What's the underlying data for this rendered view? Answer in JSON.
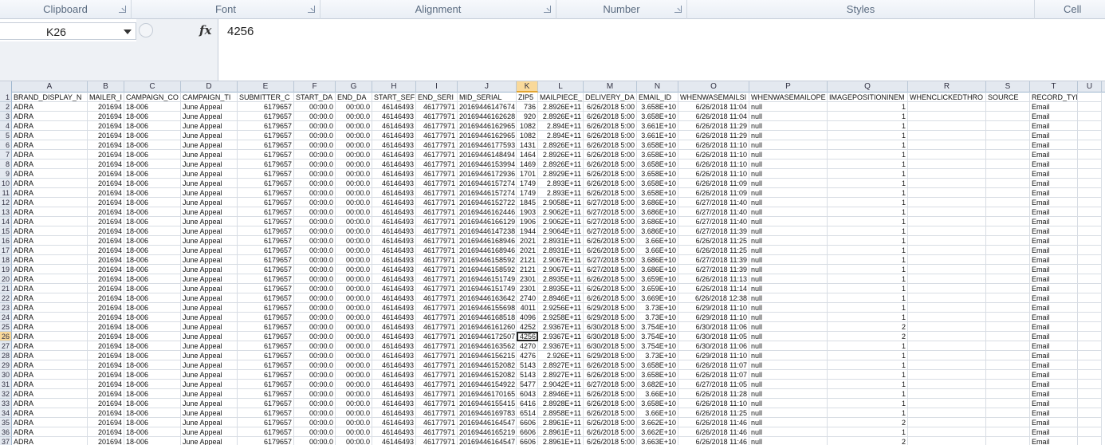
{
  "ribbon": {
    "groups": [
      "Clipboard",
      "Font",
      "Alignment",
      "Number",
      "Styles",
      "Cell"
    ]
  },
  "formula_bar": {
    "name_box": "K26",
    "fx_label": "fx",
    "value": "4256"
  },
  "sheet": {
    "column_letters": [
      "A",
      "B",
      "C",
      "D",
      "E",
      "F",
      "G",
      "H",
      "I",
      "J",
      "K",
      "L",
      "M",
      "N",
      "O",
      "P",
      "Q",
      "R",
      "S",
      "T",
      "U"
    ],
    "selected_column": "K",
    "selected_row": 26,
    "headers": [
      "BRAND_DISPLAY_N",
      "MAILER_I",
      "CAMPAIGN_CO",
      "CAMPAIGN_TI",
      "SUBMITTER_C",
      "START_DA",
      "END_DA",
      "START_SEF",
      "END_SERI",
      "MID_SERIAL",
      "ZIP5",
      "MAILPIECE_",
      "DELIVERY_DA",
      "EMAIL_ID",
      "WHENWASEMAILSI",
      "WHENWASEMAILOPE",
      "IMAGEPOSITIONINEM",
      "WHENCLICKEDTHRO",
      "SOURCE",
      "RECORD_TYPE",
      ""
    ],
    "rows": [
      [
        "ADRA",
        "201694",
        "18-006",
        "June Appeal",
        "6179657",
        "00:00.0",
        "00:00.0",
        "46146493",
        "46177971",
        "20169446147674",
        "736",
        "2.8926E+11",
        "6/26/2018 5:00",
        "3.658E+10",
        "6/26/2018 11:04",
        "null",
        "1",
        "",
        "",
        "Email",
        ""
      ],
      [
        "ADRA",
        "201694",
        "18-006",
        "June Appeal",
        "6179657",
        "00:00.0",
        "00:00.0",
        "46146493",
        "46177971",
        "20169446162628",
        "920",
        "2.8926E+11",
        "6/26/2018 5:00",
        "3.658E+10",
        "6/26/2018 11:04",
        "null",
        "1",
        "",
        "",
        "Email",
        ""
      ],
      [
        "ADRA",
        "201694",
        "18-006",
        "June Appeal",
        "6179657",
        "00:00.0",
        "00:00.0",
        "46146493",
        "46177971",
        "20169446162965",
        "1082",
        "2.894E+11",
        "6/26/2018 5:00",
        "3.661E+10",
        "6/26/2018 11:29",
        "null",
        "1",
        "",
        "",
        "Email",
        ""
      ],
      [
        "ADRA",
        "201694",
        "18-006",
        "June Appeal",
        "6179657",
        "00:00.0",
        "00:00.0",
        "46146493",
        "46177971",
        "20169446162965",
        "1082",
        "2.894E+11",
        "6/26/2018 5:00",
        "3.661E+10",
        "6/26/2018 11:29",
        "null",
        "1",
        "",
        "",
        "Email",
        ""
      ],
      [
        "ADRA",
        "201694",
        "18-006",
        "June Appeal",
        "6179657",
        "00:00.0",
        "00:00.0",
        "46146493",
        "46177971",
        "20169446177593",
        "1431",
        "2.8926E+11",
        "6/26/2018 5:00",
        "3.658E+10",
        "6/26/2018 11:10",
        "null",
        "1",
        "",
        "",
        "Email",
        ""
      ],
      [
        "ADRA",
        "201694",
        "18-006",
        "June Appeal",
        "6179657",
        "00:00.0",
        "00:00.0",
        "46146493",
        "46177971",
        "20169446148494",
        "1464",
        "2.8926E+11",
        "6/26/2018 5:00",
        "3.658E+10",
        "6/26/2018 11:10",
        "null",
        "1",
        "",
        "",
        "Email",
        ""
      ],
      [
        "ADRA",
        "201694",
        "18-006",
        "June Appeal",
        "6179657",
        "00:00.0",
        "00:00.0",
        "46146493",
        "46177971",
        "20169446153994",
        "1469",
        "2.8926E+11",
        "6/26/2018 5:00",
        "3.658E+10",
        "6/26/2018 11:10",
        "null",
        "1",
        "",
        "",
        "Email",
        ""
      ],
      [
        "ADRA",
        "201694",
        "18-006",
        "June Appeal",
        "6179657",
        "00:00.0",
        "00:00.0",
        "46146493",
        "46177971",
        "20169446172936",
        "1701",
        "2.8929E+11",
        "6/26/2018 5:00",
        "3.658E+10",
        "6/26/2018 11:10",
        "null",
        "1",
        "",
        "",
        "Email",
        ""
      ],
      [
        "ADRA",
        "201694",
        "18-006",
        "June Appeal",
        "6179657",
        "00:00.0",
        "00:00.0",
        "46146493",
        "46177971",
        "20169446157274",
        "1749",
        "2.893E+11",
        "6/26/2018 5:00",
        "3.658E+10",
        "6/26/2018 11:09",
        "null",
        "1",
        "",
        "",
        "Email",
        ""
      ],
      [
        "ADRA",
        "201694",
        "18-006",
        "June Appeal",
        "6179657",
        "00:00.0",
        "00:00.0",
        "46146493",
        "46177971",
        "20169446157274",
        "1749",
        "2.893E+11",
        "6/26/2018 5:00",
        "3.658E+10",
        "6/26/2018 11:09",
        "null",
        "1",
        "",
        "",
        "Email",
        ""
      ],
      [
        "ADRA",
        "201694",
        "18-006",
        "June Appeal",
        "6179657",
        "00:00.0",
        "00:00.0",
        "46146493",
        "46177971",
        "20169446152722",
        "1845",
        "2.9058E+11",
        "6/27/2018 5:00",
        "3.686E+10",
        "6/27/2018 11:40",
        "null",
        "1",
        "",
        "",
        "Email",
        ""
      ],
      [
        "ADRA",
        "201694",
        "18-006",
        "June Appeal",
        "6179657",
        "00:00.0",
        "00:00.0",
        "46146493",
        "46177971",
        "20169446162446",
        "1903",
        "2.9062E+11",
        "6/27/2018 5:00",
        "3.686E+10",
        "6/27/2018 11:40",
        "null",
        "1",
        "",
        "",
        "Email",
        ""
      ],
      [
        "ADRA",
        "201694",
        "18-006",
        "June Appeal",
        "6179657",
        "00:00.0",
        "00:00.0",
        "46146493",
        "46177971",
        "20169446166129",
        "1906",
        "2.9062E+11",
        "6/27/2018 5:00",
        "3.686E+10",
        "6/27/2018 11:40",
        "null",
        "1",
        "",
        "",
        "Email",
        ""
      ],
      [
        "ADRA",
        "201694",
        "18-006",
        "June Appeal",
        "6179657",
        "00:00.0",
        "00:00.0",
        "46146493",
        "46177971",
        "20169446147238",
        "1944",
        "2.9064E+11",
        "6/27/2018 5:00",
        "3.686E+10",
        "6/27/2018 11:39",
        "null",
        "1",
        "",
        "",
        "Email",
        ""
      ],
      [
        "ADRA",
        "201694",
        "18-006",
        "June Appeal",
        "6179657",
        "00:00.0",
        "00:00.0",
        "46146493",
        "46177971",
        "20169446168946",
        "2021",
        "2.8931E+11",
        "6/26/2018 5:00",
        "3.66E+10",
        "6/26/2018 11:25",
        "null",
        "1",
        "",
        "",
        "Email",
        ""
      ],
      [
        "ADRA",
        "201694",
        "18-006",
        "June Appeal",
        "6179657",
        "00:00.0",
        "00:00.0",
        "46146493",
        "46177971",
        "20169446168946",
        "2021",
        "2.8931E+11",
        "6/26/2018 5:00",
        "3.66E+10",
        "6/26/2018 11:25",
        "null",
        "1",
        "",
        "",
        "Email",
        ""
      ],
      [
        "ADRA",
        "201694",
        "18-006",
        "June Appeal",
        "6179657",
        "00:00.0",
        "00:00.0",
        "46146493",
        "46177971",
        "20169446158592",
        "2121",
        "2.9067E+11",
        "6/27/2018 5:00",
        "3.686E+10",
        "6/27/2018 11:39",
        "null",
        "1",
        "",
        "",
        "Email",
        ""
      ],
      [
        "ADRA",
        "201694",
        "18-006",
        "June Appeal",
        "6179657",
        "00:00.0",
        "00:00.0",
        "46146493",
        "46177971",
        "20169446158592",
        "2121",
        "2.9067E+11",
        "6/27/2018 5:00",
        "3.686E+10",
        "6/27/2018 11:39",
        "null",
        "1",
        "",
        "",
        "Email",
        ""
      ],
      [
        "ADRA",
        "201694",
        "18-006",
        "June Appeal",
        "6179657",
        "00:00.0",
        "00:00.0",
        "46146493",
        "46177971",
        "20169446151749",
        "2301",
        "2.8935E+11",
        "6/26/2018 5:00",
        "3.659E+10",
        "6/26/2018 11:13",
        "null",
        "1",
        "",
        "",
        "Email",
        ""
      ],
      [
        "ADRA",
        "201694",
        "18-006",
        "June Appeal",
        "6179657",
        "00:00.0",
        "00:00.0",
        "46146493",
        "46177971",
        "20169446151749",
        "2301",
        "2.8935E+11",
        "6/26/2018 5:00",
        "3.659E+10",
        "6/26/2018 11:14",
        "null",
        "1",
        "",
        "",
        "Email",
        ""
      ],
      [
        "ADRA",
        "201694",
        "18-006",
        "June Appeal",
        "6179657",
        "00:00.0",
        "00:00.0",
        "46146493",
        "46177971",
        "20169446163642",
        "2740",
        "2.8946E+11",
        "6/26/2018 5:00",
        "3.669E+10",
        "6/26/2018 12:38",
        "null",
        "1",
        "",
        "",
        "Email",
        ""
      ],
      [
        "ADRA",
        "201694",
        "18-006",
        "June Appeal",
        "6179657",
        "00:00.0",
        "00:00.0",
        "46146493",
        "46177971",
        "20169446155698",
        "4011",
        "2.9256E+11",
        "6/29/2018 5:00",
        "3.73E+10",
        "6/29/2018 11:10",
        "null",
        "1",
        "",
        "",
        "Email",
        ""
      ],
      [
        "ADRA",
        "201694",
        "18-006",
        "June Appeal",
        "6179657",
        "00:00.0",
        "00:00.0",
        "46146493",
        "46177971",
        "20169446168518",
        "4096",
        "2.9258E+11",
        "6/29/2018 5:00",
        "3.73E+10",
        "6/29/2018 11:10",
        "null",
        "1",
        "",
        "",
        "Email",
        ""
      ],
      [
        "ADRA",
        "201694",
        "18-006",
        "June Appeal",
        "6179657",
        "00:00.0",
        "00:00.0",
        "46146493",
        "46177971",
        "20169446161260",
        "4252",
        "2.9367E+11",
        "6/30/2018 5:00",
        "3.754E+10",
        "6/30/2018 11:06",
        "null",
        "2",
        "",
        "",
        "Email",
        ""
      ],
      [
        "ADRA",
        "201694",
        "18-006",
        "June Appeal",
        "6179657",
        "00:00.0",
        "00:00.0",
        "46146493",
        "46177971",
        "20169446172507",
        "4256",
        "2.9367E+11",
        "6/30/2018 5:00",
        "3.754E+10",
        "6/30/2018 11:05",
        "null",
        "2",
        "",
        "",
        "Email",
        ""
      ],
      [
        "ADRA",
        "201694",
        "18-006",
        "June Appeal",
        "6179657",
        "00:00.0",
        "00:00.0",
        "46146493",
        "46177971",
        "20169446163562",
        "4270",
        "2.9367E+11",
        "6/30/2018 5:00",
        "3.754E+10",
        "6/30/2018 11:06",
        "null",
        "1",
        "",
        "",
        "Email",
        ""
      ],
      [
        "ADRA",
        "201694",
        "18-006",
        "June Appeal",
        "6179657",
        "00:00.0",
        "00:00.0",
        "46146493",
        "46177971",
        "20169446156215",
        "4276",
        "2.926E+11",
        "6/29/2018 5:00",
        "3.73E+10",
        "6/29/2018 11:10",
        "null",
        "1",
        "",
        "",
        "Email",
        ""
      ],
      [
        "ADRA",
        "201694",
        "18-006",
        "June Appeal",
        "6179657",
        "00:00.0",
        "00:00.0",
        "46146493",
        "46177971",
        "20169446152082",
        "5143",
        "2.8927E+11",
        "6/26/2018 5:00",
        "3.658E+10",
        "6/26/2018 11:07",
        "null",
        "1",
        "",
        "",
        "Email",
        ""
      ],
      [
        "ADRA",
        "201694",
        "18-006",
        "June Appeal",
        "6179657",
        "00:00.0",
        "00:00.0",
        "46146493",
        "46177971",
        "20169446152082",
        "5143",
        "2.8927E+11",
        "6/26/2018 5:00",
        "3.658E+10",
        "6/26/2018 11:07",
        "null",
        "1",
        "",
        "",
        "Email",
        ""
      ],
      [
        "ADRA",
        "201694",
        "18-006",
        "June Appeal",
        "6179657",
        "00:00.0",
        "00:00.0",
        "46146493",
        "46177971",
        "20169446154922",
        "5477",
        "2.9042E+11",
        "6/27/2018 5:00",
        "3.682E+10",
        "6/27/2018 11:05",
        "null",
        "1",
        "",
        "",
        "Email",
        ""
      ],
      [
        "ADRA",
        "201694",
        "18-006",
        "June Appeal",
        "6179657",
        "00:00.0",
        "00:00.0",
        "46146493",
        "46177971",
        "20169446170165",
        "6043",
        "2.8946E+11",
        "6/26/2018 5:00",
        "3.66E+10",
        "6/26/2018 11:28",
        "null",
        "1",
        "",
        "",
        "Email",
        ""
      ],
      [
        "ADRA",
        "201694",
        "18-006",
        "June Appeal",
        "6179657",
        "00:00.0",
        "00:00.0",
        "46146493",
        "46177971",
        "20169446155415",
        "6416",
        "2.8928E+11",
        "6/26/2018 5:00",
        "3.658E+10",
        "6/26/2018 11:10",
        "null",
        "1",
        "",
        "",
        "Email",
        ""
      ],
      [
        "ADRA",
        "201694",
        "18-006",
        "June Appeal",
        "6179657",
        "00:00.0",
        "00:00.0",
        "46146493",
        "46177971",
        "20169446169783",
        "6514",
        "2.8958E+11",
        "6/26/2018 5:00",
        "3.66E+10",
        "6/26/2018 11:25",
        "null",
        "1",
        "",
        "",
        "Email",
        ""
      ],
      [
        "ADRA",
        "201694",
        "18-006",
        "June Appeal",
        "6179657",
        "00:00.0",
        "00:00.0",
        "46146493",
        "46177971",
        "20169446164547",
        "6606",
        "2.8961E+11",
        "6/26/2018 5:00",
        "3.662E+10",
        "6/26/2018 11:46",
        "null",
        "2",
        "",
        "",
        "Email",
        ""
      ],
      [
        "ADRA",
        "201694",
        "18-006",
        "June Appeal",
        "6179657",
        "00:00.0",
        "00:00.0",
        "46146493",
        "46177971",
        "20169446165219",
        "6606",
        "2.8961E+11",
        "6/26/2018 5:00",
        "3.662E+10",
        "6/26/2018 11:46",
        "null",
        "1",
        "",
        "",
        "Email",
        ""
      ],
      [
        "ADRA",
        "201694",
        "18-006",
        "June Appeal",
        "6179657",
        "00:00.0",
        "00:00.0",
        "46146493",
        "46177971",
        "20169446164547",
        "6606",
        "2.8961E+11",
        "6/26/2018 5:00",
        "3.663E+10",
        "6/26/2018 11:46",
        "null",
        "2",
        "",
        "",
        "Email",
        ""
      ]
    ]
  }
}
